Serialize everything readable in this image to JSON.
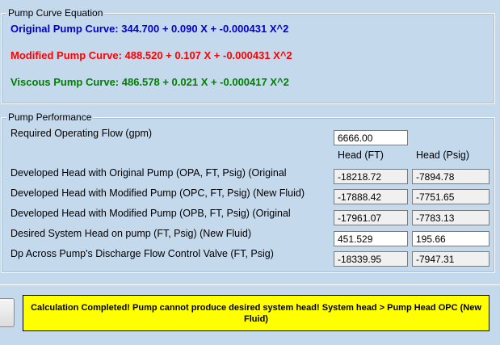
{
  "colors": {
    "original": "#0000cc",
    "modified": "#ff0000",
    "viscous": "#008000",
    "status_bg": "#ffff00"
  },
  "pump_curve": {
    "title": "Pump Curve Equation",
    "original": "Original Pump Curve: 344.700 + 0.090 X  + -0.000431 X^2",
    "modified": "Modified Pump Curve: 488.520 + 0.107 X  + -0.000431 X^2",
    "viscous": "Viscous Pump Curve: 486.578 + 0.021 X  + -0.000417 X^2"
  },
  "performance": {
    "title": "Pump Performance",
    "flow_label": "Required Operating Flow (gpm)",
    "flow_value": "6666.00",
    "col_head_ft": "Head (FT)",
    "col_head_psig": "Head (Psig)",
    "rows": [
      {
        "label": "Developed Head with Original Pump (OPA, FT, Psig) (Original",
        "ft": "-18218.72",
        "psig": "-7894.78"
      },
      {
        "label": "Developed Head with Modified Pump (OPC, FT, Psig) (New Fluid)",
        "ft": "-17888.42",
        "psig": "-7751.65"
      },
      {
        "label": "Developed Head with Modified Pump (OPB, FT, Psig) (Original",
        "ft": "-17961.07",
        "psig": "-7783.13"
      },
      {
        "label": "Desired System Head on pump (FT, Psig) (New Fluid)",
        "ft": "451.529",
        "psig": "195.66"
      },
      {
        "label": "Dp Across Pump's Discharge Flow Control Valve (FT, Psig)",
        "ft": "-18339.95",
        "psig": "-7947.31"
      }
    ]
  },
  "status_message": "Calculation Completed! Pump cannot produce desired system head! System head > Pump Head OPC (New Fluid)"
}
